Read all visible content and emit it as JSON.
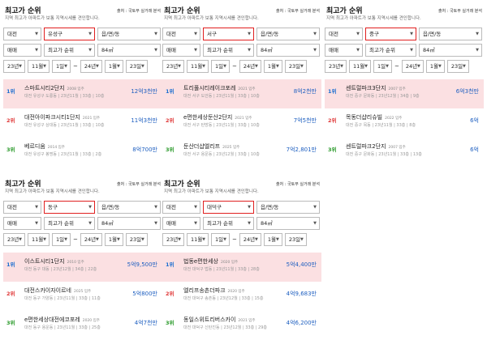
{
  "common": {
    "title": "최고가 순위",
    "source": "출처 : 국토부 실거래 분석",
    "desc": "지역 최고가 아파트가 보통 지역시세를 견인합니다.",
    "city": "대전",
    "dong": "읍/면/동",
    "trade": "매매",
    "sort": "최고가 순위",
    "area": "84㎡",
    "y1": "23년",
    "m1": "11월",
    "d1": "1일",
    "tilde": "~",
    "y2": "24년",
    "m2": "1월",
    "d2": "23일"
  },
  "panels": [
    {
      "district": "유성구",
      "items": [
        {
          "rank": "1위",
          "name": "스마트시티2단지",
          "year": "2008 입주",
          "meta": "대전 유성구 도룡동 | 23년11월 | 33층 | 10층",
          "price": "12억3천만"
        },
        {
          "rank": "2위",
          "name": "대전아이파크시티1단지",
          "year": "2021 입주",
          "meta": "대전 유성구 상대동 | 23년11월 | 33층 | 10층",
          "price": "11억3천만"
        },
        {
          "rank": "3위",
          "name": "베르디움",
          "year": "2014 입주",
          "meta": "대전 유성구 봉명동 | 23년11월 | 33층 | 2층",
          "price": "8억700만"
        }
      ]
    },
    {
      "district": "서구",
      "items": [
        {
          "rank": "1위",
          "name": "트리풀시티레이크포레",
          "year": "2021 입주",
          "meta": "대전 서구 도안동 | 23년11월 | 33층 | 10층",
          "price": "8억2천만"
        },
        {
          "rank": "2위",
          "name": "e편한세상둔산2단지",
          "year": "2021 입주",
          "meta": "대전 서구 탄방동 | 23년11월 | 33층 | 10층",
          "price": "7억5천만"
        },
        {
          "rank": "3위",
          "name": "둔산더샵엘리프",
          "year": "2025 입주",
          "meta": "대전 서구 용문동 | 23년12월 | 33층 | 10층",
          "price": "7억2,801만"
        }
      ]
    },
    {
      "district": "중구",
      "items": [
        {
          "rank": "1위",
          "name": "센트럴파크3단지",
          "year": "2007 입주",
          "meta": "대전 중구 문화동 | 23년12월 | 34층 | 9층",
          "price": "6억3천만"
        },
        {
          "rank": "2위",
          "name": "목동더샵리슈빌",
          "year": "2022 입주",
          "meta": "대전 중구 목동 | 23년11월 | 33층 | 8층",
          "price": "6억"
        },
        {
          "rank": "3위",
          "name": "센트럴파크2단지",
          "year": "2007 입주",
          "meta": "대전 중구 문화동 | 23년11월 | 33층 | 13층",
          "price": "6억"
        }
      ]
    },
    {
      "district": "동구",
      "items": [
        {
          "rank": "1위",
          "name": "이스트시티1단지",
          "year": "2010 입주",
          "meta": "대전 동구 대동 | 23년12월 | 34층 | 22층",
          "price": "5억9,500만"
        },
        {
          "rank": "2위",
          "name": "대전스카이자이르네",
          "year": "2025 입주",
          "meta": "대전 동구 가양동 | 23년11월 | 33층 | 11층",
          "price": "5억800만"
        },
        {
          "rank": "3위",
          "name": "e편한세상대전에코포레",
          "year": "2020 입주",
          "meta": "대전 동구 용운동 | 23년11월 | 33층 | 25층",
          "price": "4억7천만"
        }
      ]
    },
    {
      "district": "대덕구",
      "items": [
        {
          "rank": "1위",
          "name": "법동e편한세상",
          "year": "2020 입주",
          "meta": "대전 대덕구 법동 | 23년11월 | 33층 | 28층",
          "price": "5억4,400만"
        },
        {
          "rank": "2위",
          "name": "엘리프송촌더파크",
          "year": "2020 입주",
          "meta": "대전 대덕구 송촌동 | 23년12월 | 33층 | 15층",
          "price": "4억9,683만"
        },
        {
          "rank": "3위",
          "name": "동일스위트리버스카이",
          "year": "2021 입주",
          "meta": "대전 대덕구 신탄진동 | 23년12월 | 33층 | 29층",
          "price": "4억6,200만"
        }
      ]
    }
  ]
}
